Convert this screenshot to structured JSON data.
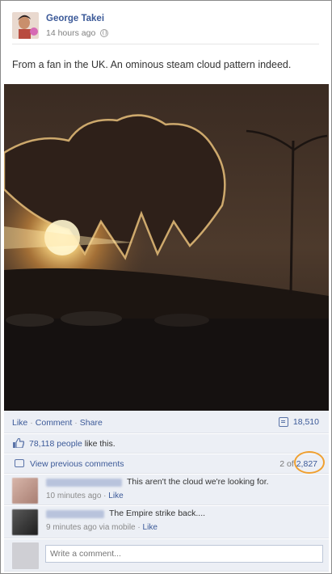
{
  "post": {
    "author": "George Takei",
    "timestamp": "14 hours ago",
    "caption": "From a fan in the UK. An ominous steam cloud pattern indeed."
  },
  "actions": {
    "like": "Like",
    "comment": "Comment",
    "share": "Share",
    "shares_count": "18,510"
  },
  "likes": {
    "count_link": "78,118 people",
    "suffix": "like this."
  },
  "comments_nav": {
    "view_previous": "View previous comments",
    "shown_prefix": "2 of ",
    "total": "2,827"
  },
  "comments": [
    {
      "text": "This aren't the cloud we're looking for.",
      "time": "10 minutes ago",
      "sep": "·",
      "like": "Like",
      "avatar_color": "#c7a49a"
    },
    {
      "text": "The Empire strike back....",
      "time": "9 minutes ago via mobile",
      "sep": "·",
      "like": "Like",
      "avatar_color": "#3b3b3b"
    }
  ],
  "write_comment": {
    "placeholder": "Write a comment..."
  },
  "colors": {
    "link": "#3b5998",
    "ufi_background": "#eceff5",
    "highlight": "#f0a030"
  }
}
